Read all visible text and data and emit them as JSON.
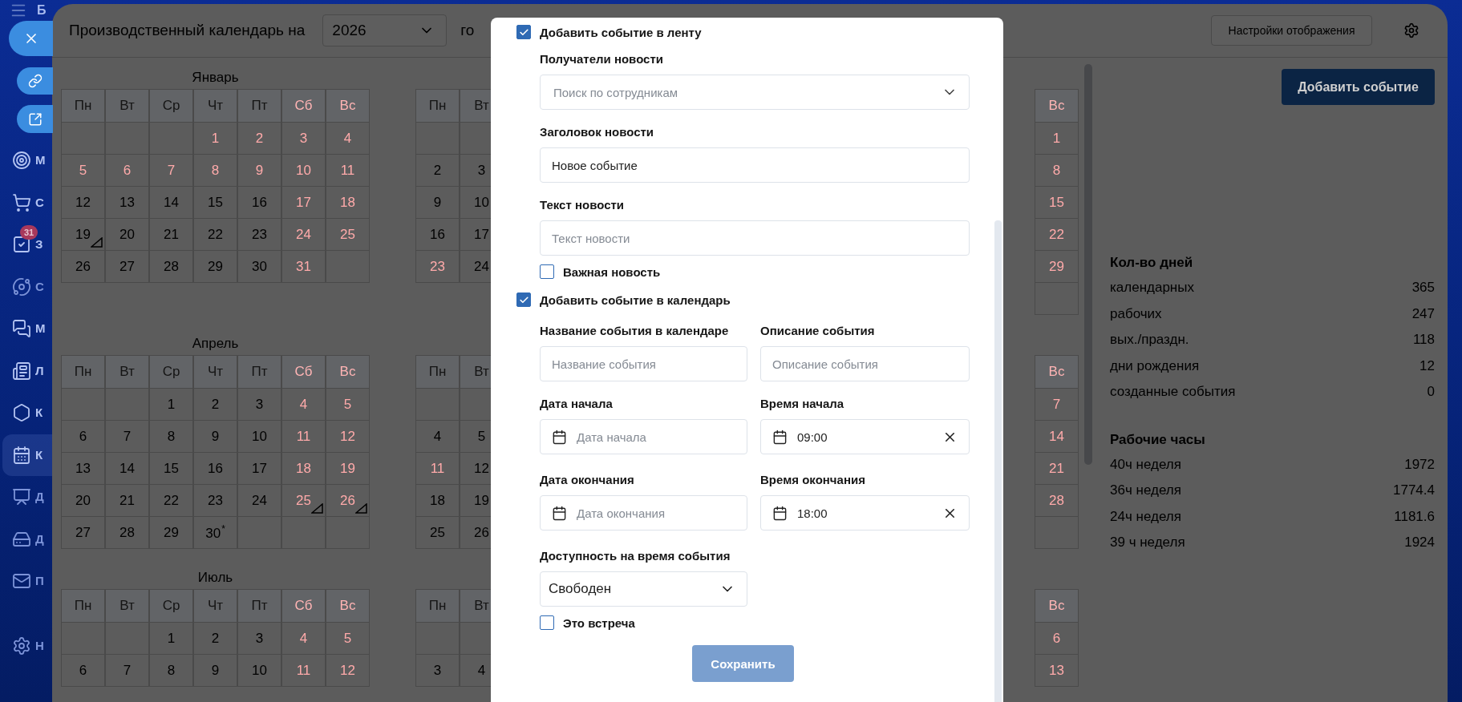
{
  "sidebar": {
    "logo": "Б",
    "items": [
      {
        "label": "М",
        "selected": false,
        "dim": false
      },
      {
        "label": "С",
        "selected": false,
        "dim": false
      },
      {
        "label": "З",
        "selected": false,
        "dim": false,
        "badge": "31"
      },
      {
        "label": "С",
        "selected": false,
        "dim": true
      },
      {
        "label": "М",
        "selected": false,
        "dim": false
      },
      {
        "label": "Л",
        "selected": false,
        "dim": false
      },
      {
        "label": "К",
        "selected": false,
        "dim": false
      },
      {
        "label": "К",
        "selected": true,
        "dim": false
      },
      {
        "label": "Д",
        "selected": false,
        "dim": true
      },
      {
        "label": "Д",
        "selected": false,
        "dim": true
      },
      {
        "label": "П",
        "selected": false,
        "dim": true
      }
    ],
    "footer": [
      {
        "label": "Н",
        "selected": false,
        "dim": true
      }
    ]
  },
  "header": {
    "title": "Производственный календарь на",
    "year": "2026",
    "suffix": "го",
    "settings_button": "Настройки отображения"
  },
  "calendar": {
    "month_rows": [
      {
        "months": [
          {
            "kind": "full",
            "title": "Январь",
            "weekdays": [
              {
                "label": "Пн",
                "off": false
              },
              {
                "label": "Вт",
                "off": false
              },
              {
                "label": "Ср",
                "off": false
              },
              {
                "label": "Чт",
                "off": false
              },
              {
                "label": "Пт",
                "off": false
              },
              {
                "label": "Сб",
                "off": true
              },
              {
                "label": "Вс",
                "off": true
              }
            ],
            "weeks": [
              [
                {
                  "kind": "empty"
                },
                {
                  "kind": "empty"
                },
                {
                  "kind": "empty"
                },
                {
                  "kind": "day",
                  "n": "1",
                  "off": true
                },
                {
                  "kind": "day",
                  "n": "2",
                  "off": true
                },
                {
                  "kind": "day",
                  "n": "3",
                  "off": true
                },
                {
                  "kind": "day",
                  "n": "4",
                  "off": true
                }
              ],
              [
                {
                  "kind": "day",
                  "n": "5",
                  "off": true
                },
                {
                  "kind": "day",
                  "n": "6",
                  "off": true
                },
                {
                  "kind": "day",
                  "n": "7",
                  "off": true
                },
                {
                  "kind": "day",
                  "n": "8",
                  "off": true
                },
                {
                  "kind": "day",
                  "n": "9",
                  "off": true
                },
                {
                  "kind": "day",
                  "n": "10",
                  "off": true
                },
                {
                  "kind": "day",
                  "n": "11",
                  "off": true
                }
              ],
              [
                {
                  "kind": "day",
                  "n": "12",
                  "off": false
                },
                {
                  "kind": "day",
                  "n": "13",
                  "off": false
                },
                {
                  "kind": "day",
                  "n": "14",
                  "off": false
                },
                {
                  "kind": "day",
                  "n": "15",
                  "off": false
                },
                {
                  "kind": "day",
                  "n": "16",
                  "off": false
                },
                {
                  "kind": "day",
                  "n": "17",
                  "off": true
                },
                {
                  "kind": "day",
                  "n": "18",
                  "off": true
                }
              ],
              [
                {
                  "kind": "day",
                  "n": "19",
                  "off": false,
                  "flag": true
                },
                {
                  "kind": "day",
                  "n": "20",
                  "off": false
                },
                {
                  "kind": "day",
                  "n": "21",
                  "off": false
                },
                {
                  "kind": "day",
                  "n": "22",
                  "off": false
                },
                {
                  "kind": "day",
                  "n": "23",
                  "off": false
                },
                {
                  "kind": "day",
                  "n": "24",
                  "off": true
                },
                {
                  "kind": "day",
                  "n": "25",
                  "off": true
                }
              ],
              [
                {
                  "kind": "day",
                  "n": "26",
                  "off": false
                },
                {
                  "kind": "day",
                  "n": "27",
                  "off": false
                },
                {
                  "kind": "day",
                  "n": "28",
                  "off": false
                },
                {
                  "kind": "day",
                  "n": "29",
                  "off": false
                },
                {
                  "kind": "day",
                  "n": "30",
                  "off": false
                },
                {
                  "kind": "day",
                  "n": "31",
                  "off": true
                },
                {
                  "kind": "empty"
                }
              ]
            ]
          },
          {
            "kind": "leading",
            "weekdays": [
              {
                "label": "Пн",
                "off": false
              },
              {
                "label": "Вт",
                "off": false
              }
            ],
            "weeks": [
              [
                {
                  "kind": "empty"
                },
                {
                  "kind": "empty"
                }
              ],
              [
                {
                  "kind": "day",
                  "n": "2",
                  "off": false
                },
                {
                  "kind": "day",
                  "n": "3",
                  "off": false
                }
              ],
              [
                {
                  "kind": "day",
                  "n": "9",
                  "off": false
                },
                {
                  "kind": "day",
                  "n": "10",
                  "off": false
                }
              ],
              [
                {
                  "kind": "day",
                  "n": "16",
                  "off": false
                },
                {
                  "kind": "day",
                  "n": "17",
                  "off": false
                }
              ],
              [
                {
                  "kind": "day",
                  "n": "23",
                  "off": true
                },
                {
                  "kind": "day",
                  "n": "24",
                  "off": false
                }
              ]
            ]
          },
          {
            "kind": "trailing",
            "weekdays": [
              {
                "label": "Вс",
                "off": true
              }
            ],
            "weeks": [
              [
                {
                  "kind": "day",
                  "n": "1",
                  "off": true
                }
              ],
              [
                {
                  "kind": "day",
                  "n": "8",
                  "off": true
                }
              ],
              [
                {
                  "kind": "day",
                  "n": "15",
                  "off": true
                }
              ],
              [
                {
                  "kind": "day",
                  "n": "22",
                  "off": true
                }
              ],
              [
                {
                  "kind": "day",
                  "n": "29",
                  "off": true
                }
              ],
              [
                {
                  "kind": "empty"
                }
              ]
            ]
          }
        ]
      },
      {
        "months": [
          {
            "kind": "full",
            "title": "Апрель",
            "weekdays": [
              {
                "label": "Пн",
                "off": false
              },
              {
                "label": "Вт",
                "off": false
              },
              {
                "label": "Ср",
                "off": false
              },
              {
                "label": "Чт",
                "off": false
              },
              {
                "label": "Пт",
                "off": false
              },
              {
                "label": "Сб",
                "off": true
              },
              {
                "label": "Вс",
                "off": true
              }
            ],
            "weeks": [
              [
                {
                  "kind": "empty"
                },
                {
                  "kind": "empty"
                },
                {
                  "kind": "day",
                  "n": "1",
                  "off": false
                },
                {
                  "kind": "day",
                  "n": "2",
                  "off": false
                },
                {
                  "kind": "day",
                  "n": "3",
                  "off": false
                },
                {
                  "kind": "day",
                  "n": "4",
                  "off": true
                },
                {
                  "kind": "day",
                  "n": "5",
                  "off": true
                }
              ],
              [
                {
                  "kind": "day",
                  "n": "6",
                  "off": false
                },
                {
                  "kind": "day",
                  "n": "7",
                  "off": false
                },
                {
                  "kind": "day",
                  "n": "8",
                  "off": false
                },
                {
                  "kind": "day",
                  "n": "9",
                  "off": false
                },
                {
                  "kind": "day",
                  "n": "10",
                  "off": false
                },
                {
                  "kind": "day",
                  "n": "11",
                  "off": true
                },
                {
                  "kind": "day",
                  "n": "12",
                  "off": true
                }
              ],
              [
                {
                  "kind": "day",
                  "n": "13",
                  "off": false
                },
                {
                  "kind": "day",
                  "n": "14",
                  "off": false
                },
                {
                  "kind": "day",
                  "n": "15",
                  "off": false
                },
                {
                  "kind": "day",
                  "n": "16",
                  "off": false
                },
                {
                  "kind": "day",
                  "n": "17",
                  "off": false
                },
                {
                  "kind": "day",
                  "n": "18",
                  "off": true
                },
                {
                  "kind": "day",
                  "n": "19",
                  "off": true
                }
              ],
              [
                {
                  "kind": "day",
                  "n": "20",
                  "off": false
                },
                {
                  "kind": "day",
                  "n": "21",
                  "off": false
                },
                {
                  "kind": "day",
                  "n": "22",
                  "off": false
                },
                {
                  "kind": "day",
                  "n": "23",
                  "off": false
                },
                {
                  "kind": "day",
                  "n": "24",
                  "off": false
                },
                {
                  "kind": "day",
                  "n": "25",
                  "off": true,
                  "flag": true
                },
                {
                  "kind": "day",
                  "n": "26",
                  "off": true,
                  "flag": true
                }
              ],
              [
                {
                  "kind": "day",
                  "n": "27",
                  "off": false
                },
                {
                  "kind": "day",
                  "n": "28",
                  "off": false
                },
                {
                  "kind": "day",
                  "n": "29",
                  "off": false
                },
                {
                  "kind": "day",
                  "n": "30",
                  "off": false,
                  "note": "*"
                },
                {
                  "kind": "empty"
                },
                {
                  "kind": "empty"
                },
                {
                  "kind": "empty"
                }
              ]
            ]
          },
          {
            "kind": "leading",
            "weekdays": [
              {
                "label": "Пн",
                "off": false
              },
              {
                "label": "Вт",
                "off": false
              }
            ],
            "weeks": [
              [
                {
                  "kind": "empty"
                },
                {
                  "kind": "empty"
                }
              ],
              [
                {
                  "kind": "day",
                  "n": "4",
                  "off": false
                },
                {
                  "kind": "day",
                  "n": "5",
                  "off": false
                }
              ],
              [
                {
                  "kind": "day",
                  "n": "11",
                  "off": true
                },
                {
                  "kind": "day",
                  "n": "12",
                  "off": false
                }
              ],
              [
                {
                  "kind": "day",
                  "n": "18",
                  "off": false
                },
                {
                  "kind": "day",
                  "n": "19",
                  "off": false
                }
              ],
              [
                {
                  "kind": "day",
                  "n": "25",
                  "off": false
                },
                {
                  "kind": "day",
                  "n": "26",
                  "off": false
                }
              ]
            ]
          },
          {
            "kind": "trailing",
            "weekdays": [
              {
                "label": "Вс",
                "off": true
              }
            ],
            "weeks": [
              [
                {
                  "kind": "day",
                  "n": "7",
                  "off": true
                }
              ],
              [
                {
                  "kind": "day",
                  "n": "14",
                  "off": true
                }
              ],
              [
                {
                  "kind": "day",
                  "n": "21",
                  "off": true
                }
              ],
              [
                {
                  "kind": "day",
                  "n": "28",
                  "off": true
                }
              ],
              [
                {
                  "kind": "empty"
                }
              ]
            ]
          }
        ]
      },
      {
        "months": [
          {
            "kind": "full",
            "title": "Июль",
            "weekdays": [
              {
                "label": "Пн",
                "off": false
              },
              {
                "label": "Вт",
                "off": false
              },
              {
                "label": "Ср",
                "off": false
              },
              {
                "label": "Чт",
                "off": false
              },
              {
                "label": "Пт",
                "off": false
              },
              {
                "label": "Сб",
                "off": true
              },
              {
                "label": "Вс",
                "off": true
              }
            ],
            "weeks": [
              [
                {
                  "kind": "empty"
                },
                {
                  "kind": "empty"
                },
                {
                  "kind": "day",
                  "n": "1",
                  "off": false
                },
                {
                  "kind": "day",
                  "n": "2",
                  "off": false
                },
                {
                  "kind": "day",
                  "n": "3",
                  "off": false
                },
                {
                  "kind": "day",
                  "n": "4",
                  "off": true
                },
                {
                  "kind": "day",
                  "n": "5",
                  "off": true
                }
              ],
              [
                {
                  "kind": "day",
                  "n": "6",
                  "off": false
                },
                {
                  "kind": "day",
                  "n": "7",
                  "off": false
                },
                {
                  "kind": "day",
                  "n": "8",
                  "off": false
                },
                {
                  "kind": "day",
                  "n": "9",
                  "off": false
                },
                {
                  "kind": "day",
                  "n": "10",
                  "off": false
                },
                {
                  "kind": "day",
                  "n": "11",
                  "off": true
                },
                {
                  "kind": "day",
                  "n": "12",
                  "off": true
                }
              ]
            ]
          },
          {
            "kind": "leading",
            "weekdays": [
              {
                "label": "Пн",
                "off": false
              },
              {
                "label": "Вт",
                "off": false
              }
            ],
            "weeks": [
              [
                {
                  "kind": "empty"
                },
                {
                  "kind": "empty"
                }
              ],
              [
                {
                  "kind": "day",
                  "n": "3",
                  "off": false
                },
                {
                  "kind": "day",
                  "n": "4",
                  "off": false
                }
              ]
            ]
          },
          {
            "kind": "trailing",
            "weekdays": [
              {
                "label": "Вс",
                "off": true
              }
            ],
            "weeks": [
              [
                {
                  "kind": "day",
                  "n": "6",
                  "off": true
                }
              ],
              [
                {
                  "kind": "day",
                  "n": "13",
                  "off": true
                }
              ]
            ]
          }
        ]
      }
    ]
  },
  "summary": {
    "add_button": "Добавить событие",
    "sections": [
      {
        "title": "Кол-во дней",
        "rows": [
          {
            "label": "календарных",
            "value": "365"
          },
          {
            "label": "рабочих",
            "value": "247"
          },
          {
            "label": "вых./праздн.",
            "value": "118"
          },
          {
            "label": "дни рождения",
            "value": "12"
          },
          {
            "label": "созданные события",
            "value": "0"
          }
        ]
      },
      {
        "title": "Рабочие часы",
        "rows": [
          {
            "label": "40ч неделя",
            "value": "1972"
          },
          {
            "label": "36ч неделя",
            "value": "1774.4"
          },
          {
            "label": "24ч неделя",
            "value": "1181.6"
          },
          {
            "label": "39 ч неделя",
            "value": "1924"
          }
        ]
      }
    ]
  },
  "dialog": {
    "feed_checkbox": {
      "label": "Добавить событие в ленту",
      "checked": true
    },
    "recipients": {
      "label": "Получатели новости",
      "placeholder": "Поиск по сотрудникам"
    },
    "news_title": {
      "label": "Заголовок новости",
      "value": "Новое событие"
    },
    "news_text": {
      "label": "Текст новости",
      "placeholder": "Текст новости"
    },
    "important": {
      "label": "Важная новость",
      "checked": false
    },
    "calendar_checkbox": {
      "label": "Добавить событие в календарь",
      "checked": true
    },
    "event_name": {
      "label": "Название события в календаре",
      "placeholder": "Название события"
    },
    "event_description": {
      "label": "Описание события",
      "placeholder": "Описание события"
    },
    "start_date": {
      "label": "Дата начала",
      "placeholder": "Дата начала"
    },
    "start_time": {
      "label": "Время начала",
      "value": "09:00"
    },
    "end_date": {
      "label": "Дата окончания",
      "placeholder": "Дата окончания"
    },
    "end_time": {
      "label": "Время окончания",
      "value": "18:00"
    },
    "availability": {
      "label": "Доступность на время события",
      "value": "Свободен"
    },
    "meeting": {
      "label": "Это встреча",
      "checked": false
    },
    "save_button": {
      "label": "Сохранить",
      "disabled": true
    }
  }
}
